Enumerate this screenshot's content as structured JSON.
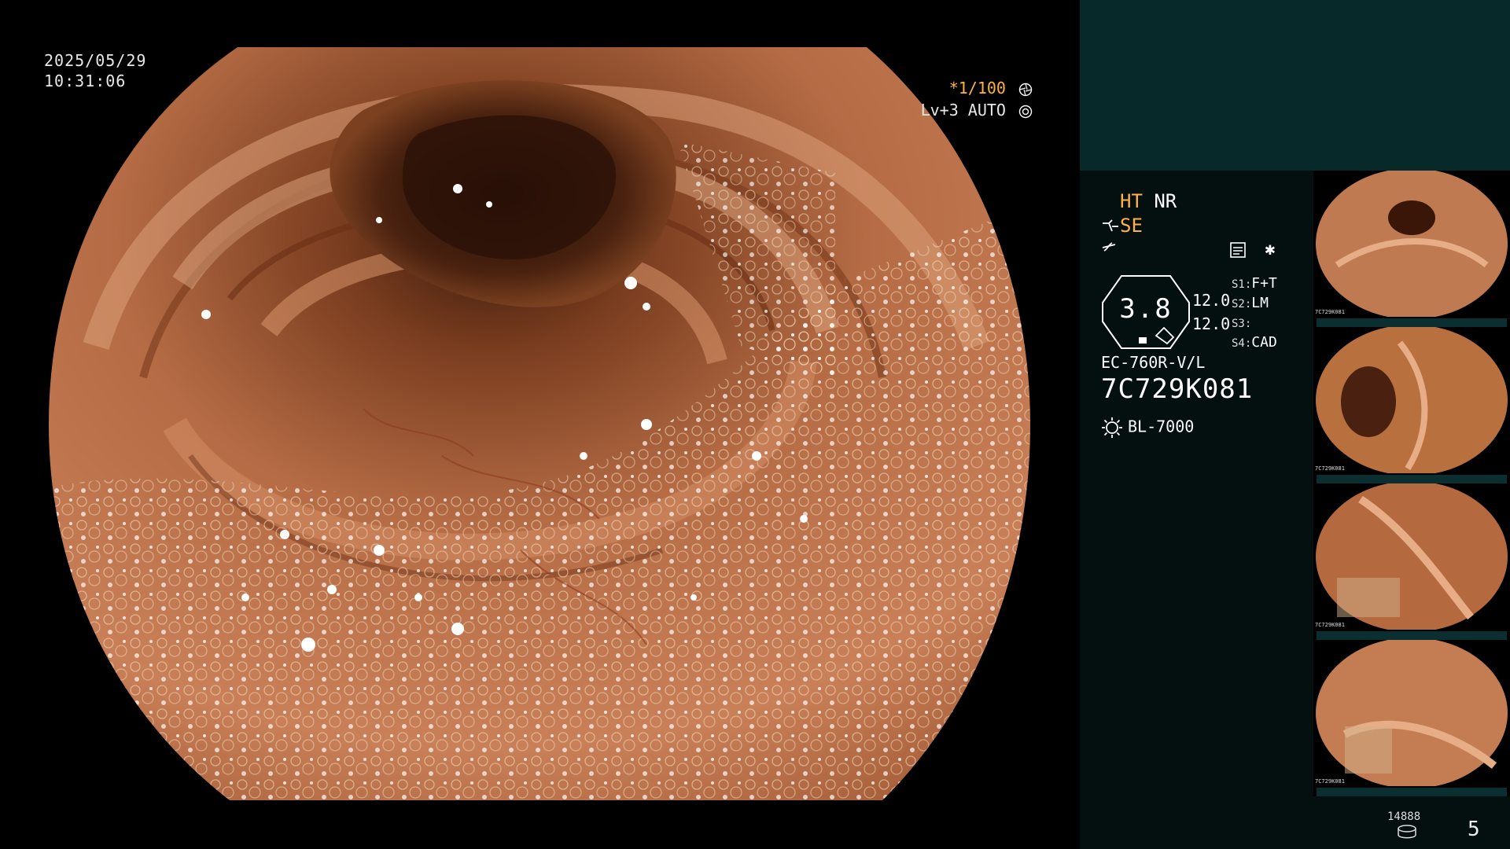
{
  "overlay": {
    "date": "2025/05/29",
    "time": "10:31:06",
    "shutter": "*1/100",
    "level": "Lv+3 AUTO"
  },
  "panel": {
    "ht": "HT",
    "nr": "NR",
    "se": "SE",
    "gauge_value": "3.8",
    "gauge_left_top": "12.0",
    "gauge_left_bottom": "12.0",
    "switches": [
      {
        "key": "S1:",
        "value": "F+T"
      },
      {
        "key": "S2:",
        "value": "LM"
      },
      {
        "key": "S3:",
        "value": ""
      },
      {
        "key": "S4:",
        "value": "CAD"
      }
    ],
    "scope_model": "EC-760R-V/L",
    "scope_serial": "7C729K081",
    "light_source": "BL-7000",
    "image_count_label": "14888",
    "image_count": "5"
  },
  "thumbnails": [
    {
      "id": "7C729K081"
    },
    {
      "id": "7C729K081"
    },
    {
      "id": "7C729K081"
    },
    {
      "id": "7C729K081"
    }
  ],
  "colors": {
    "accent": "#ffb347",
    "panel_top": "#08292a",
    "panel_bg": "#040f0f",
    "mucosa": "#b06a44"
  },
  "icons": [
    "aperture-icon",
    "auto-iris-icon",
    "enhance-icon",
    "freeze-icon",
    "record-icon",
    "light-source-icon",
    "database-icon"
  ]
}
